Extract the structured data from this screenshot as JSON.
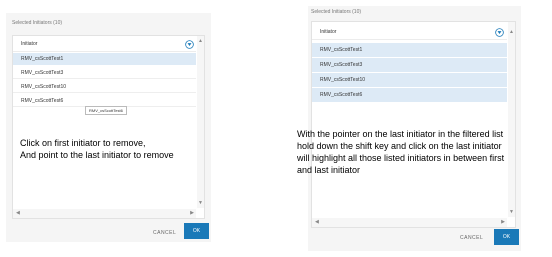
{
  "left_dialog": {
    "title": "Selected Initiators (10)",
    "column_header": "Initiator",
    "rows": [
      "RMV_csScottTest1",
      "RMV_csScottTest3",
      "RMV_csScottTest10",
      "RMV_csScottTest6"
    ],
    "tooltip": "RMV_csScottTest6",
    "cancel_label": "CANCEL",
    "ok_label": "OK",
    "note_line1": "Click on first initiator to remove,",
    "note_line2": "And point to the last initiator to remove"
  },
  "right_dialog": {
    "title": "Selected Initiators (10)",
    "column_header": "Initiator",
    "rows": [
      "RMV_csScottTest1",
      "RMV_csScottTest3",
      "RMV_csScottTest10",
      "RMV_csScottTest6"
    ],
    "cancel_label": "CANCEL",
    "ok_label": "OK",
    "note_line1": "With the pointer on the last initiator in the filtered list",
    "note_line2": "hold down the shift key and click on the last initiator",
    "note_line3": "will highlight all those listed initiators in between first",
    "note_line4": "and last initiator"
  },
  "colors": {
    "accent": "#1a79b8",
    "selection": "#ddeaf6"
  }
}
